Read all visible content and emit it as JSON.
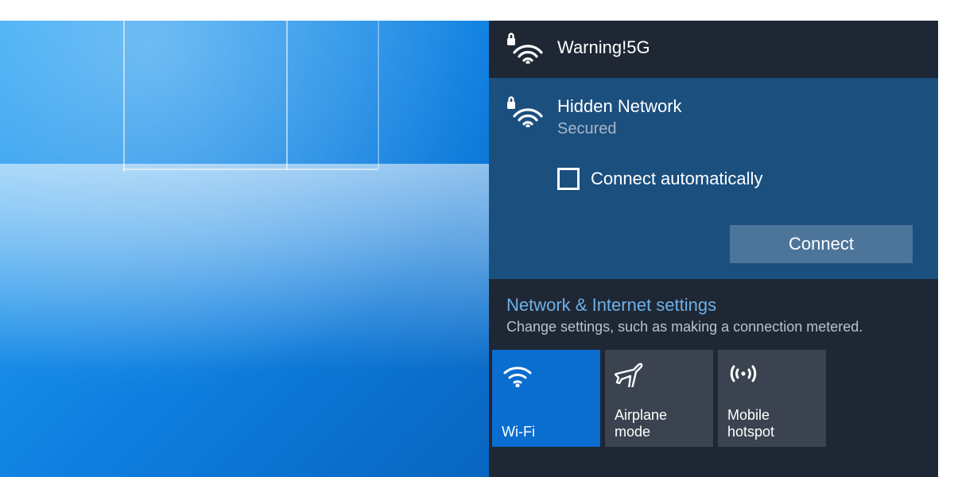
{
  "networks": [
    {
      "ssid": "Warning!5G",
      "secured": true
    },
    {
      "ssid": "Hidden Network",
      "status": "Secured",
      "secured": true,
      "auto_label": "Connect automatically",
      "connect_label": "Connect"
    }
  ],
  "settings": {
    "title": "Network & Internet settings",
    "subtitle": "Change settings, such as making a connection metered."
  },
  "tiles": {
    "wifi": "Wi-Fi",
    "airplane": "Airplane mode",
    "hotspot": "Mobile hotspot"
  }
}
